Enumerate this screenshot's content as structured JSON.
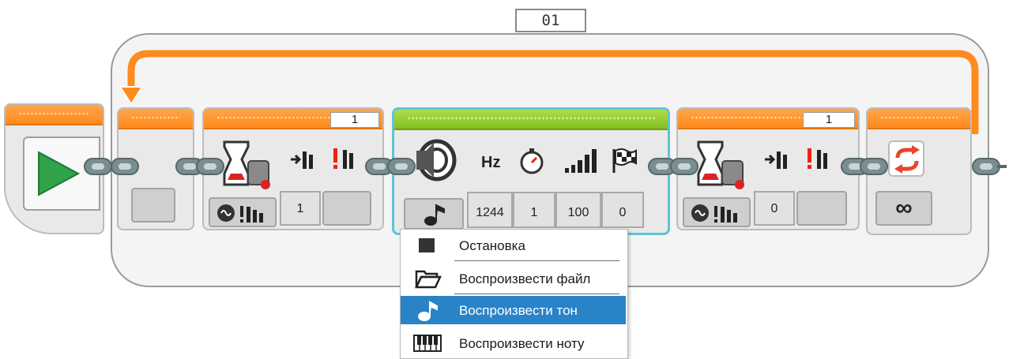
{
  "loop": {
    "name": "01",
    "wait_count_1": "1",
    "wait_count_2": "1"
  },
  "sound": {
    "headers": {
      "freq": "Hz"
    },
    "params": {
      "frequency": "1244",
      "duration": "1",
      "volume": "100",
      "play_type": "0"
    }
  },
  "wait_1": {
    "value": "1"
  },
  "wait_2": {
    "value": "0"
  },
  "loop_end": {
    "mode": "∞"
  },
  "mode_menu": {
    "items": [
      {
        "label": "Остановка",
        "icon": "stop-square-icon"
      },
      {
        "label": "Воспроизвести файл",
        "icon": "open-folder-icon"
      },
      {
        "label": "Воспроизвести тон",
        "icon": "note-icon",
        "selected": true
      },
      {
        "label": "Воспроизвести ноту",
        "icon": "piano-keys-icon"
      }
    ]
  },
  "colors": {
    "orange": "#ff8a1e",
    "green": "#84c021",
    "teal_plug": "#7a8e92",
    "selected": "#2a83c7"
  }
}
